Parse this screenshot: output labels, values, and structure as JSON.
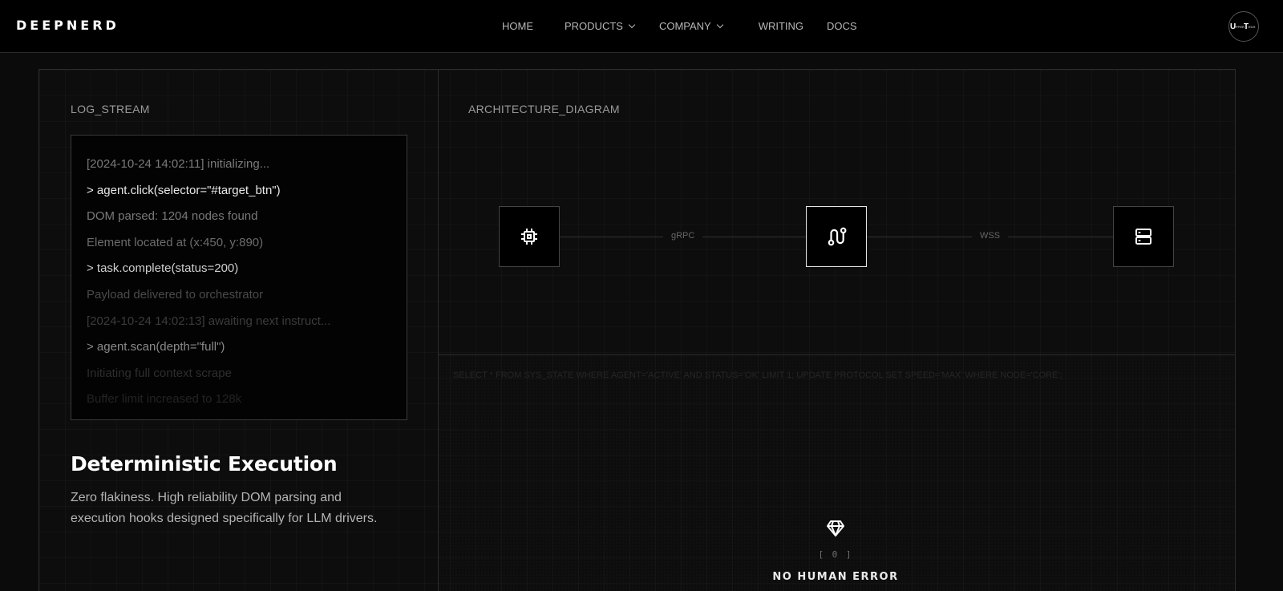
{
  "nav": {
    "logo": "DEEPNERD",
    "links": [
      {
        "label": "HOME",
        "dropdown": false
      },
      {
        "label": "PRODUCTS",
        "dropdown": true
      },
      {
        "label": "COMPANY",
        "dropdown": true
      },
      {
        "label": "WRITING",
        "dropdown": false
      },
      {
        "label": "DOCS",
        "dropdown": false
      }
    ],
    "avatar_text": "UPPERTECH"
  },
  "log_panel": {
    "label": "LOG_STREAM",
    "lines": [
      {
        "text": "[2024-10-24 14:02:11] initializing...",
        "color": "#7a7a7a"
      },
      {
        "text": "> agent.click(selector=\"#target_btn\")",
        "color": "#e8e8e8"
      },
      {
        "text": "DOM parsed: 1204 nodes found",
        "color": "#7a7a7a"
      },
      {
        "text": "Element located at (x:450, y:890)",
        "color": "#6c6c6c"
      },
      {
        "text": "> task.complete(status=200)",
        "color": "#cfcfcf"
      },
      {
        "text": "Payload delivered to orchestrator",
        "color": "#4a4a4a"
      },
      {
        "text": "[2024-10-24 14:02:13] awaiting next instruct...",
        "color": "#3c3c3c"
      },
      {
        "text": "> agent.scan(depth=\"full\")",
        "color": "#8a8a8a"
      },
      {
        "text": "Initiating full context scrape",
        "color": "#2e2e2e"
      },
      {
        "text": "Buffer limit increased to 128k",
        "color": "#232323"
      }
    ],
    "feature_title": "Deterministic Execution",
    "feature_desc": "Zero flakiness. High reliability DOM parsing and execution hooks designed specifically for LLM drivers."
  },
  "diagram": {
    "label": "ARCHITECTURE_DIAGRAM",
    "nodes": [
      {
        "icon": "cpu-icon",
        "active": false
      },
      {
        "icon": "route-icon",
        "active": true
      },
      {
        "icon": "server-icon",
        "active": false
      }
    ],
    "connections": [
      "gRPC",
      "WSS"
    ]
  },
  "metric": {
    "query": "SELECT * FROM SYS_STATE WHERE AGENT='ACTIVE' AND STATUS='OK' LIMIT 1; UPDATE PROTOCOL SET SPEED='MAX' WHERE NODE='CORE';",
    "icon": "diamond-icon",
    "counter": "[ 0 ]",
    "title": "NO HUMAN ERROR"
  },
  "colors": {
    "background": "#0b0b0b",
    "nav": "#000000",
    "accent": "#ffffff",
    "border": "#2c2c2c"
  }
}
